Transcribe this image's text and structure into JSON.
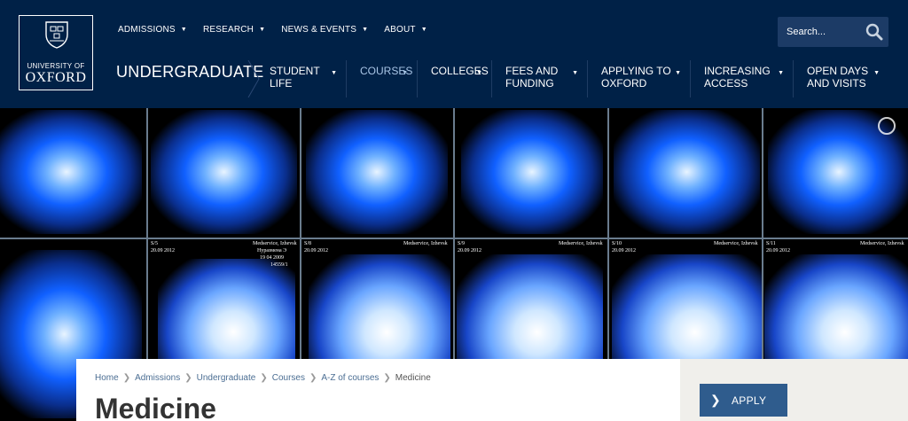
{
  "logo": {
    "line1": "UNIVERSITY OF",
    "line2": "OXFORD"
  },
  "top_nav": [
    {
      "label": "ADMISSIONS"
    },
    {
      "label": "RESEARCH"
    },
    {
      "label": "NEWS & EVENTS"
    },
    {
      "label": "ABOUT"
    }
  ],
  "search": {
    "placeholder": "Search..."
  },
  "section_title": "UNDERGRADUATE",
  "main_nav": [
    {
      "label": "STUDENT LIFE",
      "line1": "STUDENT",
      "line2": "LIFE"
    },
    {
      "label": "COURSES",
      "line1": "COURSES",
      "line2": ""
    },
    {
      "label": "COLLEGES",
      "line1": "COLLEGES",
      "line2": ""
    },
    {
      "label": "FEES AND FUNDING",
      "line1": "FEES AND",
      "line2": "FUNDING"
    },
    {
      "label": "APPLYING TO OXFORD",
      "line1": "APPLYING TO",
      "line2": "OXFORD"
    },
    {
      "label": "INCREASING ACCESS",
      "line1": "INCREASING",
      "line2": "ACCESS"
    },
    {
      "label": "OPEN DAYS AND VISITS",
      "line1": "OPEN DAYS",
      "line2": "AND VISITS"
    }
  ],
  "hero": {
    "film_labels": [
      "Medservice, Izhevsk",
      "20.09 2012",
      "Нуразмена Э",
      "19 04 2009",
      "14559/1"
    ],
    "slice_numbers": [
      "S/5",
      "S/8",
      "S/9",
      "S/10",
      "S/11"
    ]
  },
  "breadcrumb": [
    "Home",
    "Admissions",
    "Undergraduate",
    "Courses",
    "A-Z of courses",
    "Medicine"
  ],
  "page_title": "Medicine",
  "apply_label": "APPLY",
  "colors": {
    "navy": "#002147",
    "apply": "#2f5c8d",
    "sidebar": "#f0efeb"
  }
}
